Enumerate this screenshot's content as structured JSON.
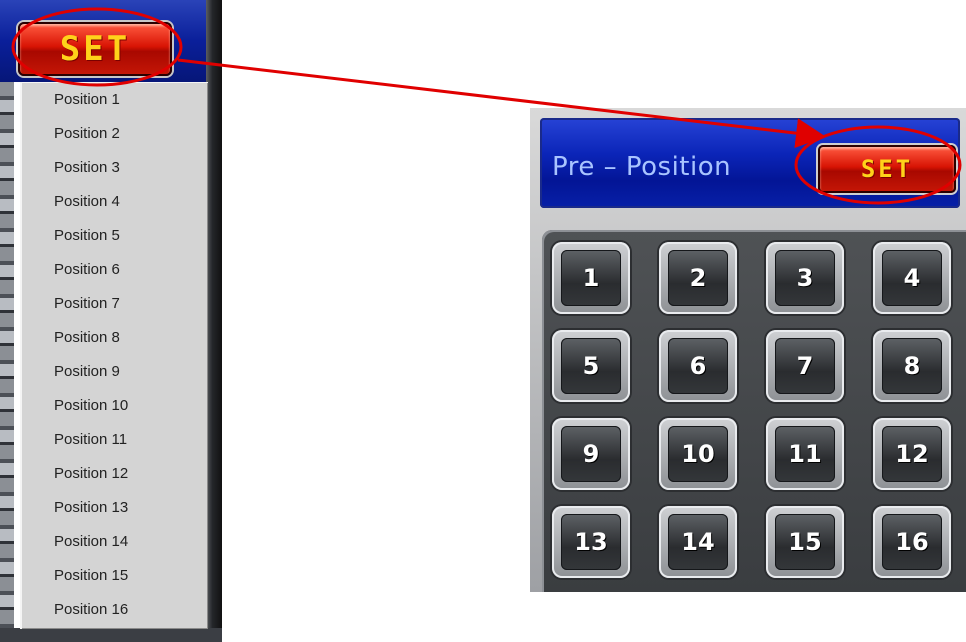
{
  "left_panel": {
    "set_label": "SET",
    "menu_items": [
      "Position 1",
      "Position 2",
      "Position 3",
      "Position 4",
      "Position 5",
      "Position 6",
      "Position 7",
      "Position 8",
      "Position 9",
      "Position 10",
      "Position 11",
      "Position 12",
      "Position 13",
      "Position 14",
      "Position 15",
      "Position 16"
    ]
  },
  "right_panel": {
    "title": "Pre – Position",
    "set_label": "SET",
    "presets": [
      "1",
      "2",
      "3",
      "4",
      "5",
      "6",
      "7",
      "8",
      "9",
      "10",
      "11",
      "12",
      "13",
      "14",
      "15",
      "16"
    ]
  },
  "annotation": {
    "color": "#e00000"
  }
}
